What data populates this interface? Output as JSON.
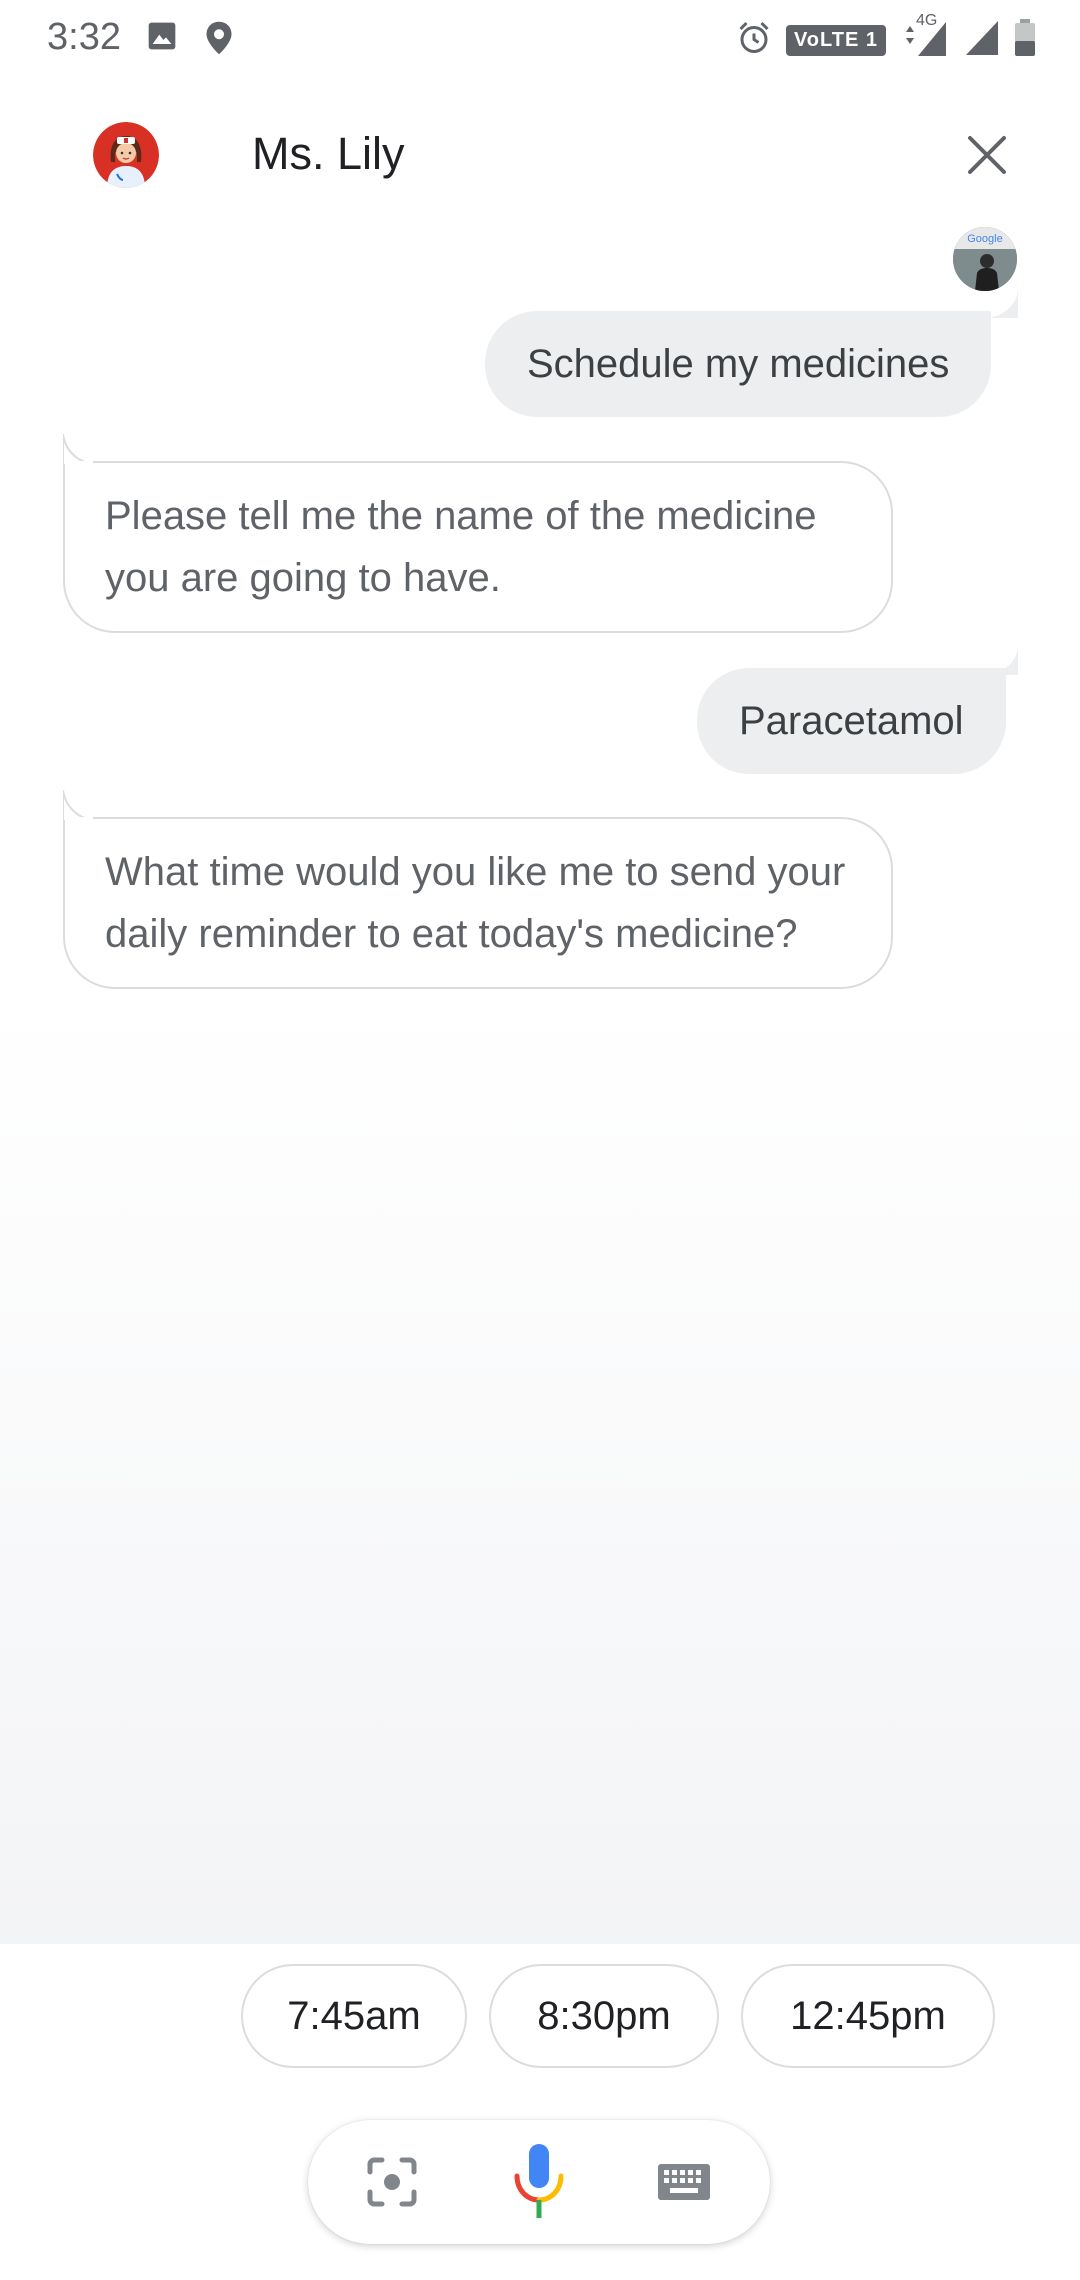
{
  "status_bar": {
    "time": "3:32",
    "network_badge": "VoLTE 1",
    "network_type": "4G",
    "icons": [
      "image-icon",
      "location-icon",
      "alarm-icon",
      "signal-icon",
      "signal-icon",
      "battery-icon"
    ]
  },
  "header": {
    "agent_name": "Ms. Lily",
    "close_icon": "close-icon"
  },
  "messages": [
    {
      "sender": "user",
      "text": "Schedule my medicines"
    },
    {
      "sender": "agent",
      "text": "Please tell me the name of the medicine you are going to have."
    },
    {
      "sender": "user",
      "text": "Paracetamol"
    },
    {
      "sender": "agent",
      "text": "What time would you like me to send your daily reminder to eat today's medicine?"
    }
  ],
  "suggestions": [
    "7:45am",
    "8:30pm",
    "12:45pm"
  ],
  "input_bar": {
    "icons": [
      "lens-icon",
      "microphone-icon",
      "keyboard-icon"
    ]
  },
  "colors": {
    "user_bubble": "#eceef0",
    "agent_bubble_border": "#dadce0",
    "mic_blue": "#4285f4",
    "mic_red": "#ea4335",
    "mic_yellow": "#fbbc04",
    "mic_green": "#34a853"
  }
}
